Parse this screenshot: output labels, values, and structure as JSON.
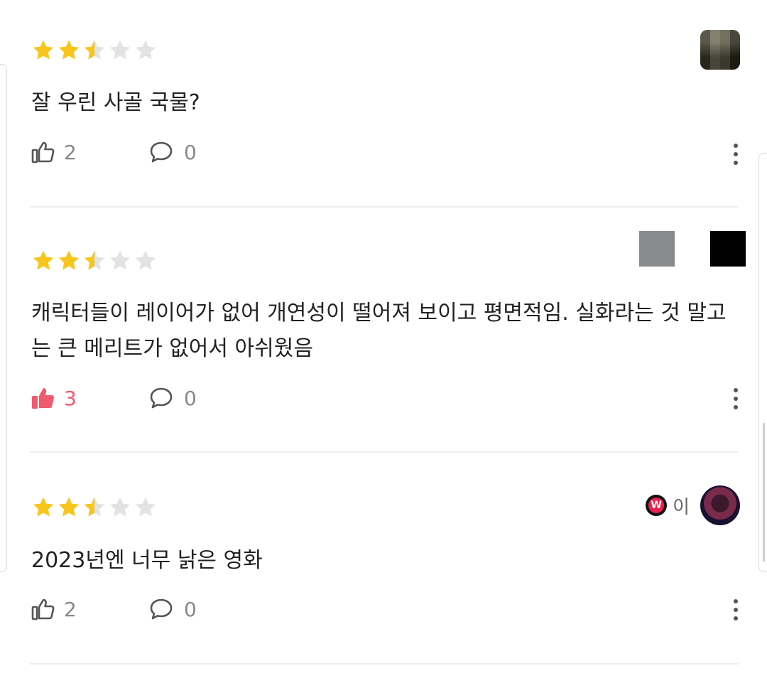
{
  "reviews": [
    {
      "rating": 2.5,
      "username": "",
      "text": "잘 우린 사골 국물?",
      "likes": "2",
      "comments": "0",
      "liked": false
    },
    {
      "rating": 2.5,
      "username": "",
      "text": "캐릭터들이 레이어가 없어 개연성이 떨어져 보이고 평면적임. 실화라는 것 말고는 큰 메리트가 없어서 아쉬웠음",
      "likes": "3",
      "comments": "0",
      "liked": true
    },
    {
      "rating": 2.5,
      "username": "이",
      "badge": "W",
      "text": "2023년엔 너무 낡은 영화",
      "likes": "2",
      "comments": "0",
      "liked": false
    }
  ],
  "colors": {
    "star_filled": "#f8c51c",
    "star_empty": "#e3e3e3",
    "liked_accent": "#f05a6d",
    "muted": "#888888",
    "badge": "#e8204f"
  },
  "icons": {
    "rating": "star-icon",
    "like": "thumbs-up-icon",
    "comment": "speech-bubble-icon",
    "more": "more-vertical-icon"
  }
}
